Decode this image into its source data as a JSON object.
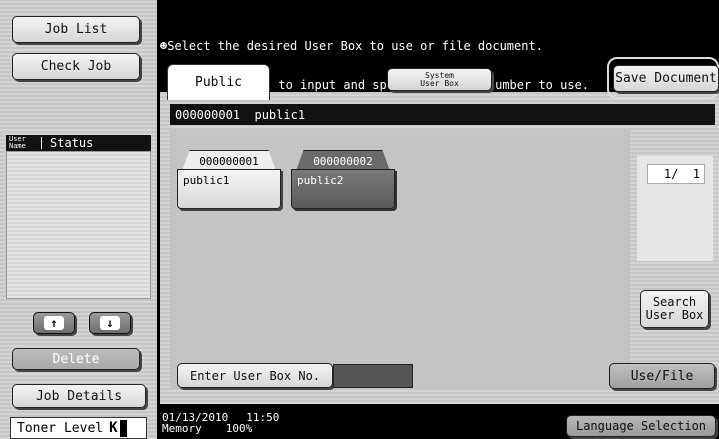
{
  "left_panel": {
    "job_list_label": "Job List",
    "check_job_label": "Check Job",
    "col_user_name": "User Name",
    "col_status": "Status",
    "up_arrow": "↑",
    "down_arrow": "↓",
    "delete_label": "Delete",
    "job_details_label": "Job Details",
    "toner_label": "Toner Level",
    "toner_color": "K"
  },
  "header": {
    "message_line1": "Select the desired User Box to use or file document.",
    "message_line2": "Use the keypad to input and specify the box number to use."
  },
  "tabs": {
    "public_label": "Public",
    "system_line1": "System",
    "system_line2": "User Box",
    "save_document_label": "Save Document"
  },
  "selected_box": "000000001  public1",
  "boxes": [
    {
      "number": "000000001",
      "name": "public1"
    },
    {
      "number": "000000002",
      "name": "public2"
    }
  ],
  "page_indicator": "1/  1",
  "search_line1": "Search",
  "search_line2": "User Box",
  "enter_box_label": "Enter User Box No.",
  "enter_box_value": "",
  "use_file_label": "Use/File",
  "footer": {
    "date": "01/13/2010",
    "time": "11:50",
    "memory_label": "Memory",
    "memory_value": "100%",
    "language_label": "Language Selection"
  }
}
